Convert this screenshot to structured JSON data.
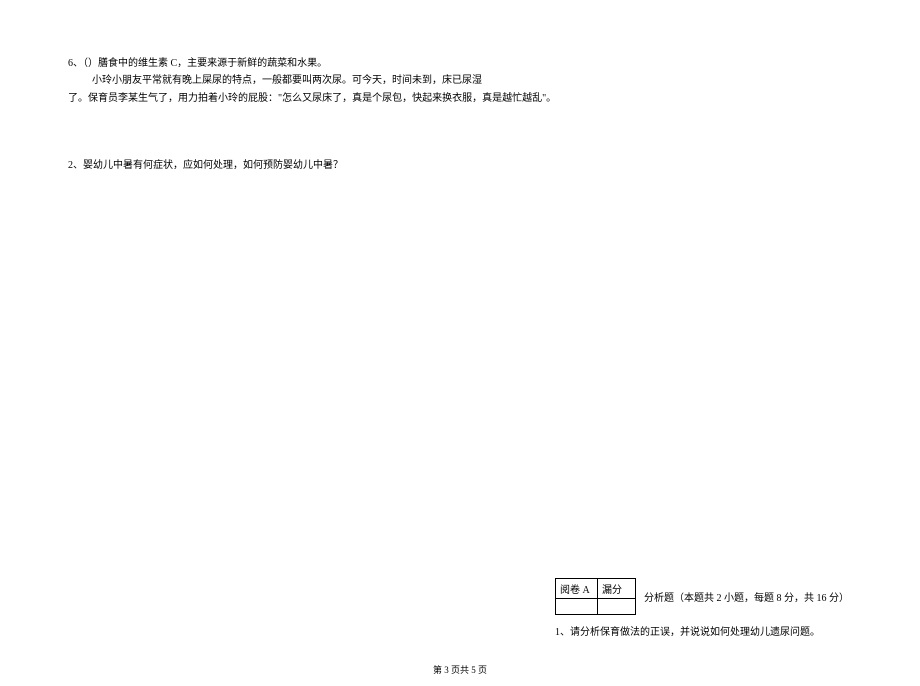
{
  "top": {
    "q6": "6、（）膳食中的维生素 C，主要来源于新鲜的蔬菜和水果。",
    "story_line1": "小玲小朋友平常就有晚上屎尿的特点，一般都要叫两次尿。可今天，时间未到，床已尿湿",
    "story_line2": "了。保育员李某生气了，用力拍着小玲的屁股：\"怎么又尿床了，真是个尿包，快起来换衣服，真是越忙越乱\"。",
    "q2": "2、婴幼儿中暑有何症状，应如何处理，如何预防婴幼儿中暑？"
  },
  "bottom": {
    "score_header1": "阅卷 A",
    "score_header2": "漏分",
    "analysis_title": "分析题（本题共 2 小题，每题 8 分，共 16 分）",
    "analysis_q1": "1、请分析保育做法的正误，并说说如何处理幼儿遗尿问题。"
  },
  "footer": {
    "page_info": "第 3 页共 5 页"
  }
}
